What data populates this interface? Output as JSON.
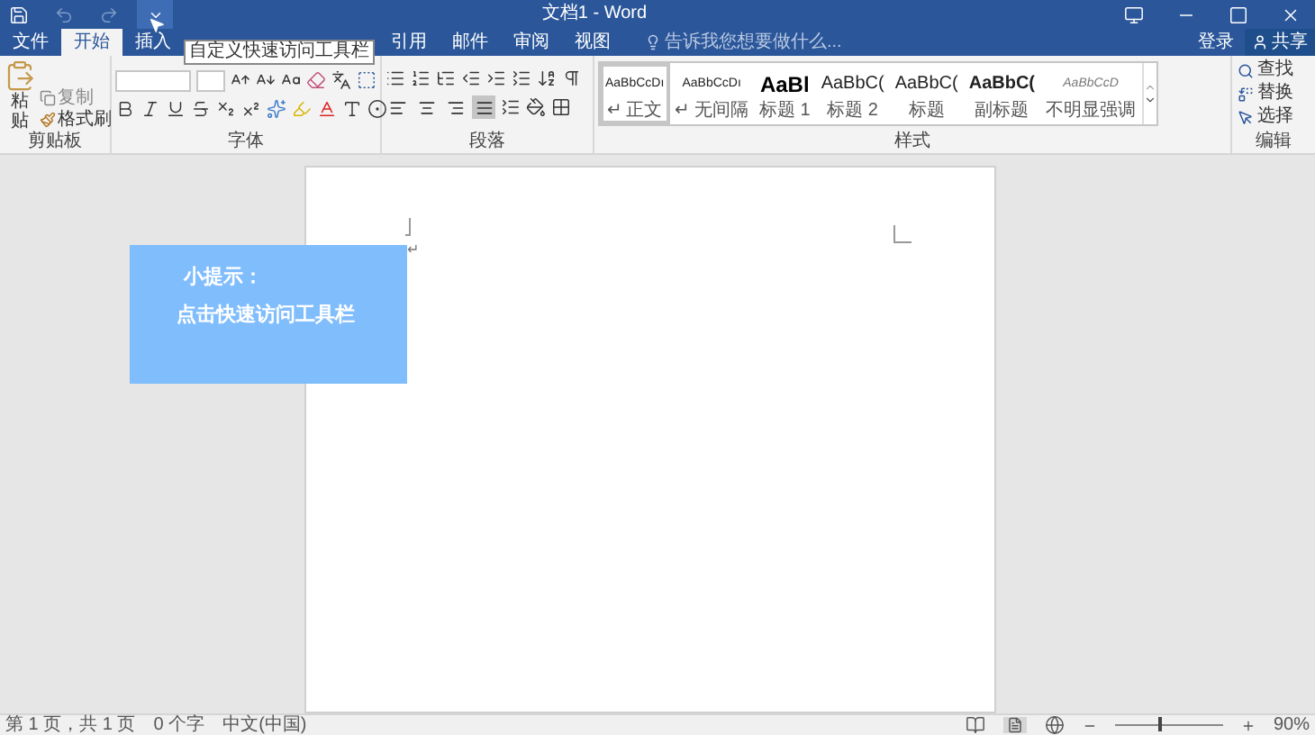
{
  "title_bar": {
    "title": "文档1 - Word"
  },
  "tooltip": {
    "text": "自定义快速访问工具栏"
  },
  "tabs": [
    {
      "label": "文件",
      "selected": false
    },
    {
      "label": "开始",
      "selected": true
    },
    {
      "label": "插入",
      "selected": false
    },
    {
      "label": "引用",
      "selected": false
    },
    {
      "label": "邮件",
      "selected": false
    },
    {
      "label": "审阅",
      "selected": false
    },
    {
      "label": "视图",
      "selected": false
    }
  ],
  "tell_me": {
    "placeholder": "告诉我您想要做什么..."
  },
  "account": {
    "sign_in": "登录",
    "share": "共享"
  },
  "ribbon": {
    "clipboard": {
      "label": "剪贴板",
      "paste": "粘贴",
      "copy": "复制",
      "format_painter": "格式刷"
    },
    "font": {
      "label": "字体"
    },
    "paragraph": {
      "label": "段落",
      "alignments": [
        {
          "kind": "left",
          "selected": false
        },
        {
          "kind": "center",
          "selected": false
        },
        {
          "kind": "right",
          "selected": false
        },
        {
          "kind": "justify",
          "selected": true
        }
      ]
    },
    "styles": {
      "label": "样式",
      "items": [
        {
          "sample": "AaBbCcDı",
          "name": "↵ 正文",
          "kind": "normal",
          "selected": true
        },
        {
          "sample": "AaBbCcDı",
          "name": "↵ 无间隔",
          "kind": "normal",
          "selected": false
        },
        {
          "sample": "AaBl",
          "name": "标题 1",
          "kind": "heading1",
          "selected": false
        },
        {
          "sample": "AaBbC(",
          "name": "标题 2",
          "kind": "heading2",
          "selected": false
        },
        {
          "sample": "AaBbC(",
          "name": "标题",
          "kind": "heading2",
          "selected": false
        },
        {
          "sample": "AaBbC(",
          "name": "副标题",
          "kind": "subtitle",
          "selected": false
        },
        {
          "sample": "AaBbCcD",
          "name": "不明显强调",
          "kind": "emphasis",
          "selected": false
        }
      ]
    },
    "editing": {
      "label": "编辑",
      "find": "查找",
      "replace": "替换",
      "select": "选择"
    }
  },
  "document": {
    "paragraph_mark": "↵"
  },
  "tip": {
    "title": "小提示：",
    "text": "点击快速访问工具栏"
  },
  "status_bar": {
    "page": "第 1 页，共 1 页",
    "words": "0 个字",
    "language": "中文(中国)",
    "zoom": "90%",
    "zoom_slider": {
      "level": 0.4
    }
  }
}
